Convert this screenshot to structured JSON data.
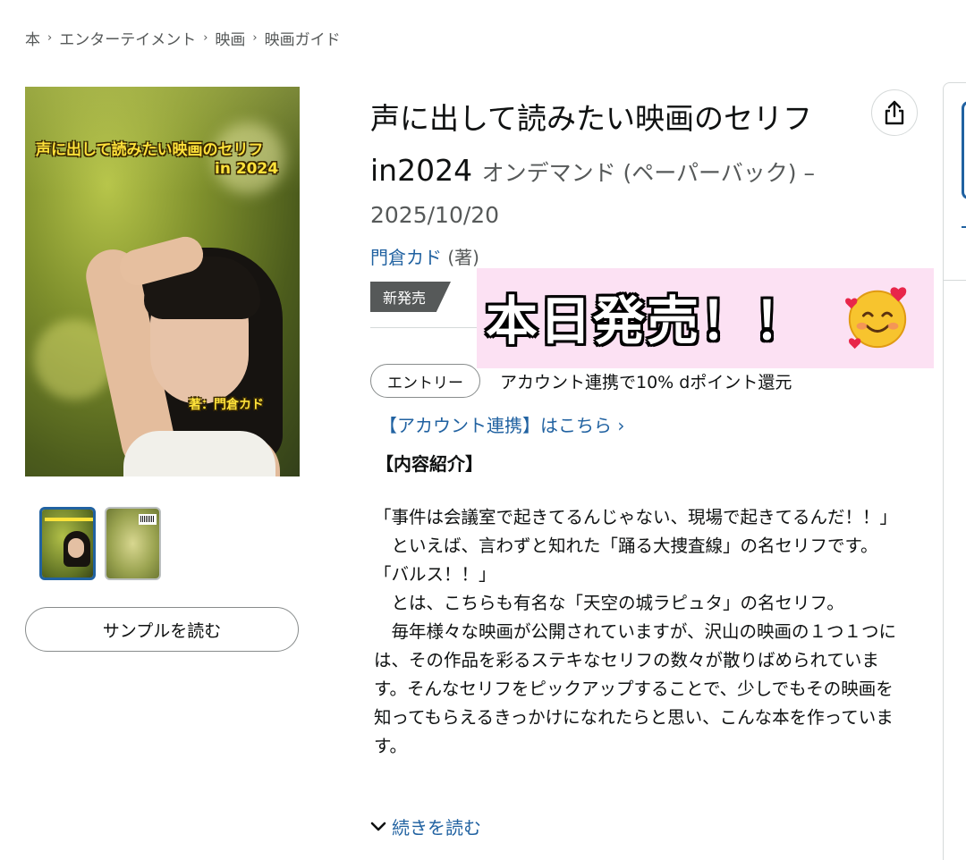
{
  "breadcrumb": [
    "本",
    "エンターテイメント",
    "映画",
    "映画ガイド"
  ],
  "book": {
    "title": "声に出して読みたい映画のセリフin2024",
    "format": "オンデマンド (ペーパーバック) –",
    "pub_date": "2025/10/20",
    "author_name": "門倉カド",
    "author_role": "(著)",
    "badge": "新発売"
  },
  "cover": {
    "title_line1": "声に出して読みたい映画のセリフ",
    "title_line2": "in 2024",
    "author": "著：門倉カド"
  },
  "sample_button": "サンプルを読む",
  "sticker": {
    "text": "本日発売！！",
    "emoji": "smiling-face-with-hearts"
  },
  "entry": {
    "pill": "エントリー",
    "text": "アカウント連携で10% dポイント還元"
  },
  "account_link": "【アカウント連携】はこちら ›",
  "section_heading": "【内容紹介】",
  "description": "「事件は会議室で起きてるんじゃない、現場で起きてるんだ！！」\n　といえば、言わずと知れた「踊る大捜査線」の名セリフです。\n「バルス！！」\n　とは、こちらも有名な「天空の城ラピュタ」の名セリフ。\n　毎年様々な映画が公開されていますが、沢山の映画の１つ１つには、その作品を彩るステキなセリフの数々が散りばめられています。そんなセリフをピックアップすることで、少しでもその映画を知ってもらえるきっかけになれたらと思い、こんな本を作っています。",
  "read_more": "続きを読む",
  "colors": {
    "link": "#2162a1",
    "badge_bg": "#565959",
    "sticker_bg": "#fce1f3"
  }
}
